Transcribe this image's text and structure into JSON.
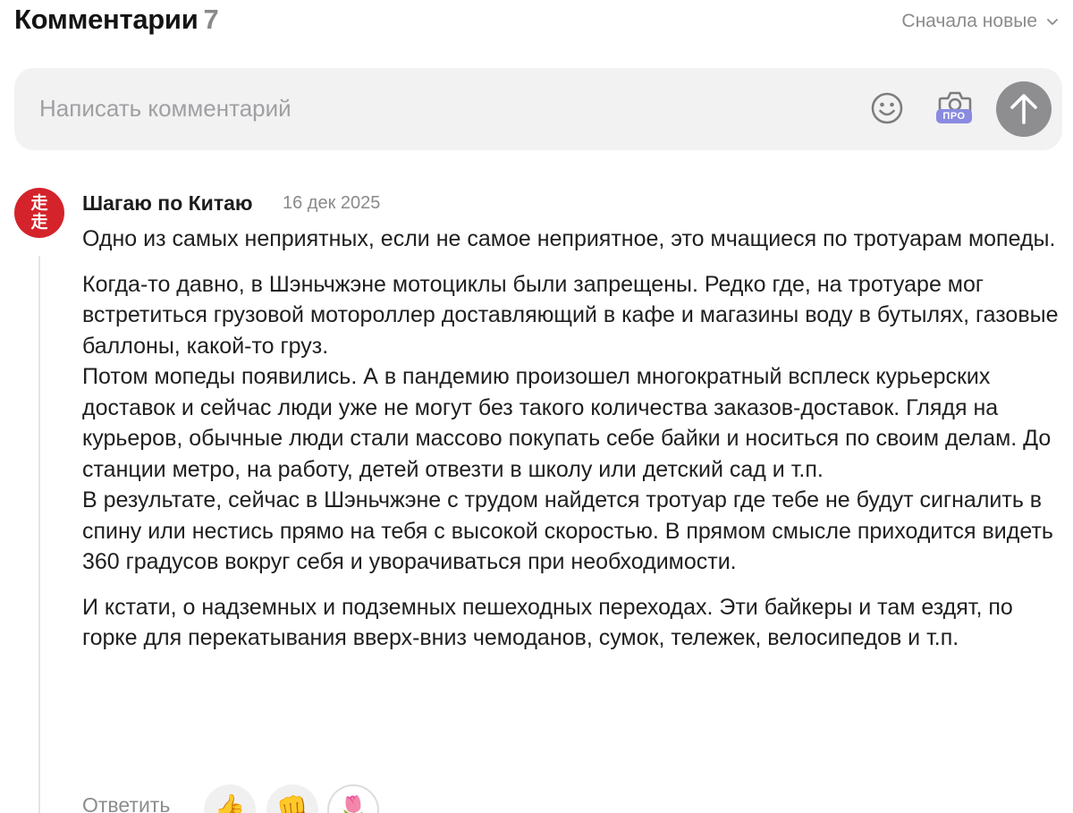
{
  "header": {
    "title": "Комментарии",
    "count": "7",
    "sort_label": "Сначала новые"
  },
  "compose": {
    "placeholder": "Написать комментарий",
    "pro_badge": "ПРО"
  },
  "comment": {
    "avatar_glyph_top": "走",
    "avatar_glyph_bottom": "走",
    "author": "Шагаю по Китаю",
    "date": "16 дек 2025",
    "paragraphs": [
      "Одно из самых неприятных, если не самое неприятное, это мчащиеся по тротуарам мопеды.",
      "Когда-то давно, в Шэньчжэне мотоциклы были запрещены. Редко где, на тротуаре мог встретиться грузовой мотороллер доставляющий в кафе и магазины воду в бутылях, газовые баллоны, какой-то груз.\nПотом мопеды появились. А в пандемию произошел многократный всплеск курьерских доставок и сейчас люди уже не могут без такого количества заказов-доставок. Глядя на курьеров, обычные люди стали массово покупать себе байки и носиться по своим делам. До станции метро, на работу, детей отвезти в школу или детский сад и т.п.\nВ результате, сейчас в Шэньчжэне с трудом найдется тротуар где тебе не будут сигналить в спину или нестись прямо на тебя с высокой скоростью. В прямом смысле приходится видеть 360 градусов вокруг себя и уворачиваться при необходимости.",
      "И кстати, о надземных и подземных пешеходных переходах. Эти байкеры и там ездят, по горке для перекатывания вверх-вниз чемоданов, сумок, тележек, велосипедов и т.п."
    ],
    "reply_label": "Ответить",
    "reactions": [
      {
        "icon": "thumbs-up-icon",
        "glyph": "👍"
      },
      {
        "icon": "fist-bump-icon",
        "glyph": "👊"
      },
      {
        "icon": "tulips-icon",
        "glyph": "🌷"
      }
    ]
  },
  "colors": {
    "avatar_bg": "#d4232a",
    "send_button": "#8e8e90",
    "pro_badge": "#8a8ae0",
    "compose_bg": "#f2f2f3"
  }
}
